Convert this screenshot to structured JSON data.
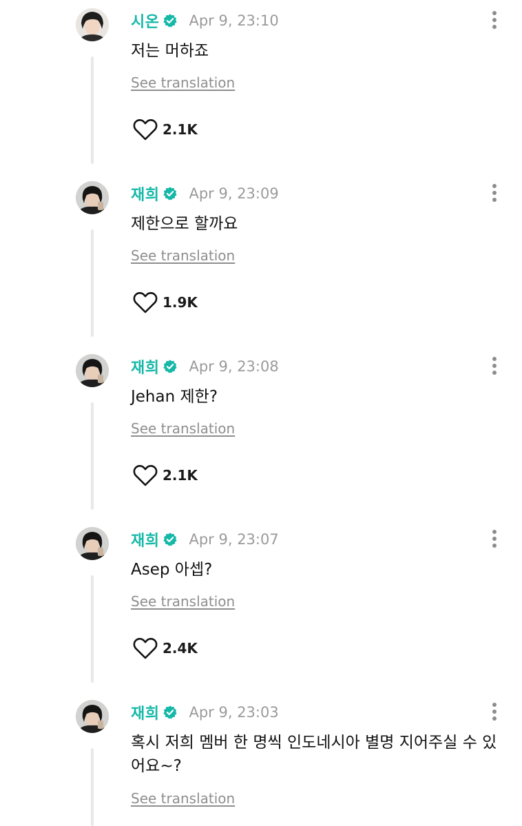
{
  "colors": {
    "author": "#16b8a8",
    "verified_badge": "#16b8a8",
    "timestamp": "#9a9a9a",
    "link": "#8e8e8e",
    "thread_line": "#e8e8e8"
  },
  "icons": {
    "verified": "verified-badge-icon",
    "more": "more-vertical-icon",
    "like": "heart-outline-icon"
  },
  "comments": [
    {
      "author": "시온",
      "timestamp": "Apr 9, 23:10",
      "text": "저는 머하죠",
      "translate_label": "See translation",
      "likes": "2.1K"
    },
    {
      "author": "재희",
      "timestamp": "Apr 9, 23:09",
      "text": "제한으로 할까요",
      "translate_label": "See translation",
      "likes": "1.9K"
    },
    {
      "author": "재희",
      "timestamp": "Apr 9, 23:08",
      "text": "Jehan 제한?",
      "translate_label": "See translation",
      "likes": "2.1K"
    },
    {
      "author": "재희",
      "timestamp": "Apr 9, 23:07",
      "text": "Asep 아셉?",
      "translate_label": "See translation",
      "likes": "2.4K"
    },
    {
      "author": "재희",
      "timestamp": "Apr 9, 23:03",
      "text": "혹시 저희 멤버 한 명씩 인도네시아 별명 지어주실 수 있어요~?",
      "translate_label": "See translation"
    }
  ]
}
